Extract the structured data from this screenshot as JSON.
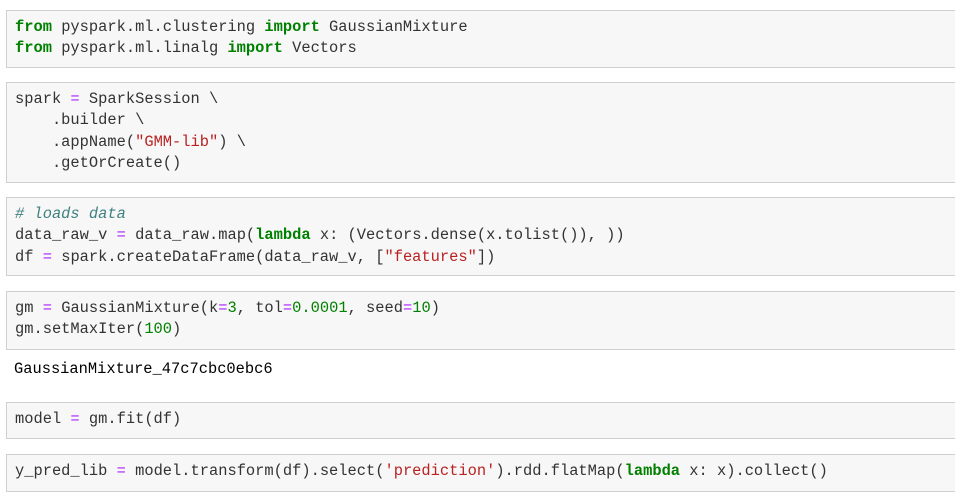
{
  "cells": [
    {
      "id": "imports",
      "lines": [
        [
          [
            "kw",
            "from"
          ],
          [
            "pl",
            " pyspark.ml.clustering "
          ],
          [
            "kw",
            "import"
          ],
          [
            "pl",
            " GaussianMixture"
          ]
        ],
        [
          [
            "kw",
            "from"
          ],
          [
            "pl",
            " pyspark.ml.linalg "
          ],
          [
            "kw",
            "import"
          ],
          [
            "pl",
            " Vectors"
          ]
        ]
      ]
    },
    {
      "id": "spark-session",
      "lines": [
        [
          [
            "pl",
            "spark "
          ],
          [
            "op",
            "="
          ],
          [
            "pl",
            " SparkSession \\"
          ]
        ],
        [
          [
            "pl",
            "    .builder \\"
          ]
        ],
        [
          [
            "pl",
            "    .appName"
          ],
          [
            "pl",
            "("
          ],
          [
            "str",
            "\"GMM-lib\""
          ],
          [
            "pl",
            ") \\"
          ]
        ],
        [
          [
            "pl",
            "    .getOrCreate"
          ],
          [
            "pl",
            "()"
          ]
        ]
      ]
    },
    {
      "id": "load-data",
      "lines": [
        [
          [
            "cm",
            "# loads data"
          ]
        ],
        [
          [
            "pl",
            "data_raw_v "
          ],
          [
            "op",
            "="
          ],
          [
            "pl",
            " data_raw.map("
          ],
          [
            "kw",
            "lambda"
          ],
          [
            "pl",
            " x: (Vectors.dense(x.tolist()), ))"
          ]
        ],
        [
          [
            "pl",
            "df "
          ],
          [
            "op",
            "="
          ],
          [
            "pl",
            " spark.createDataFrame(data_raw_v, ["
          ],
          [
            "str",
            "\"features\""
          ],
          [
            "pl",
            "])"
          ]
        ]
      ]
    },
    {
      "id": "model-setup",
      "lines": [
        [
          [
            "pl",
            "gm "
          ],
          [
            "op",
            "="
          ],
          [
            "pl",
            " GaussianMixture(k"
          ],
          [
            "op",
            "="
          ],
          [
            "num",
            "3"
          ],
          [
            "pl",
            ", tol"
          ],
          [
            "op",
            "="
          ],
          [
            "num",
            "0.0001"
          ],
          [
            "pl",
            ", seed"
          ],
          [
            "op",
            "="
          ],
          [
            "num",
            "10"
          ],
          [
            "pl",
            ")"
          ]
        ],
        [
          [
            "pl",
            "gm.setMaxIter("
          ],
          [
            "num",
            "100"
          ],
          [
            "pl",
            ")"
          ]
        ]
      ]
    },
    {
      "id": "fit",
      "lines": [
        [
          [
            "pl",
            "model "
          ],
          [
            "op",
            "="
          ],
          [
            "pl",
            " gm.fit(df)"
          ]
        ]
      ]
    },
    {
      "id": "predict",
      "lines": [
        [
          [
            "pl",
            "y_pred_lib "
          ],
          [
            "op",
            "="
          ],
          [
            "pl",
            " model.transform(df).select("
          ],
          [
            "str",
            "'prediction'"
          ],
          [
            "pl",
            ").rdd.flatMap("
          ],
          [
            "kw",
            "lambda"
          ],
          [
            "pl",
            " x: x).collect()"
          ]
        ]
      ]
    }
  ],
  "output": {
    "text": "GaussianMixture_47c7cbc0ebc6"
  }
}
